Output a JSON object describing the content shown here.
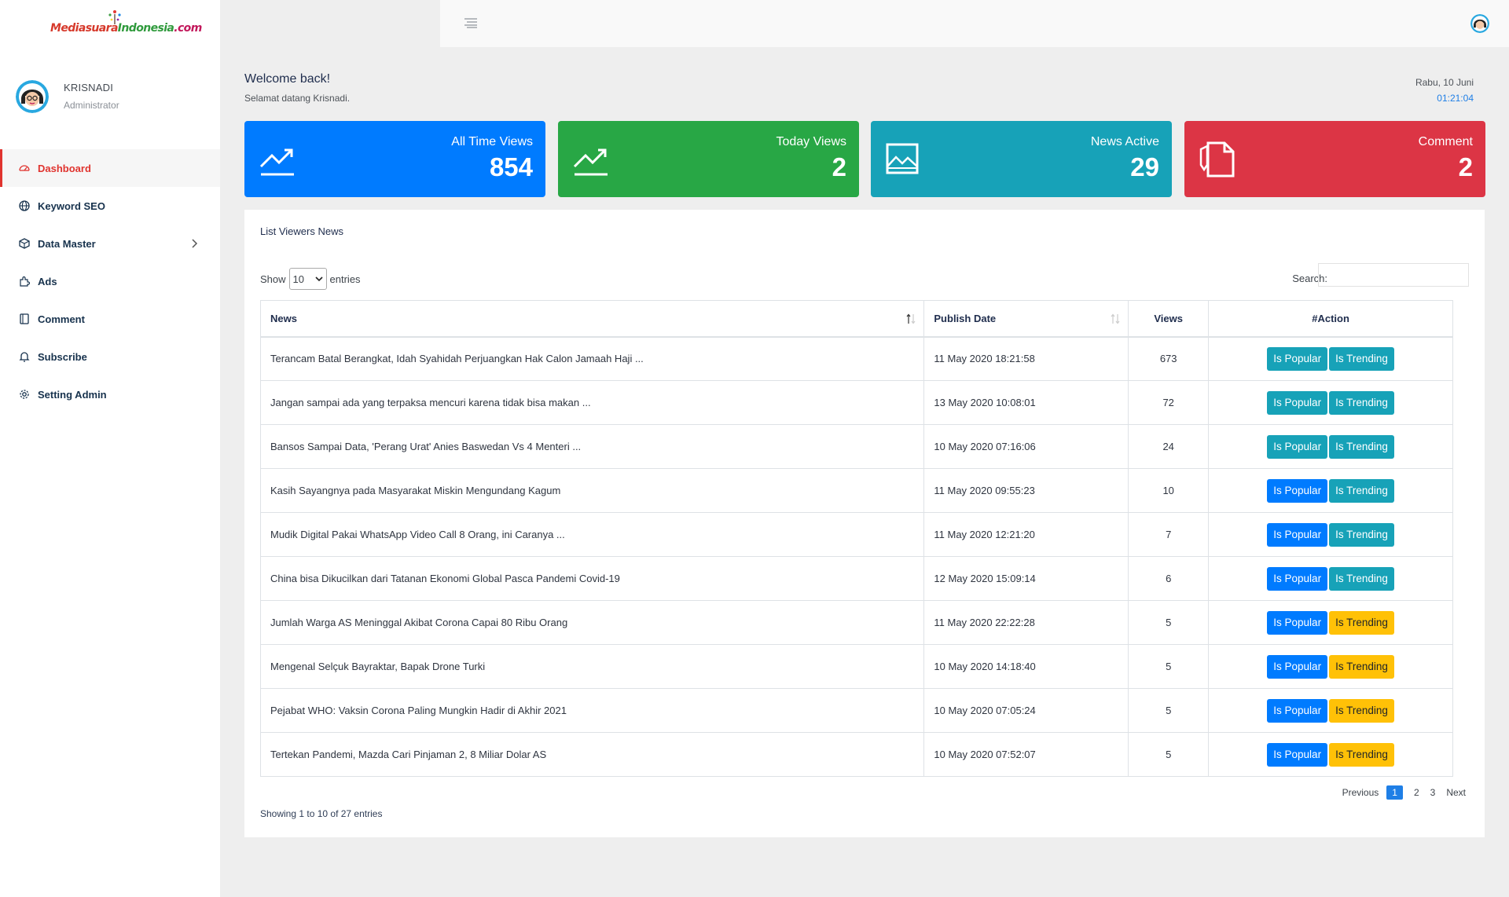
{
  "brand": {
    "logo_text_1": "Mediasuara",
    "logo_text_2": "Indonesia",
    "logo_text_3": ".com"
  },
  "profile": {
    "name": "KRISNADI",
    "role": "Administrator"
  },
  "sidebar": {
    "items": [
      {
        "label": "Dashboard",
        "icon": "speedometer-icon"
      },
      {
        "label": "Keyword SEO",
        "icon": "globe-icon"
      },
      {
        "label": "Data Master",
        "icon": "box-icon"
      },
      {
        "label": "Ads",
        "icon": "puzzle-icon"
      },
      {
        "label": "Comment",
        "icon": "book-icon"
      },
      {
        "label": "Subscribe",
        "icon": "bell-icon"
      },
      {
        "label": "Setting Admin",
        "icon": "gear-icon"
      }
    ]
  },
  "header": {
    "welcome": "Welcome back!",
    "welcome_sub": "Selamat datang Krisnadi.",
    "date": "Rabu, 10 Juni",
    "time": "01:21:04"
  },
  "cards": [
    {
      "title": "All Time Views",
      "value": "854",
      "color": "#007bff",
      "icon": "trend-up-icon"
    },
    {
      "title": "Today Views",
      "value": "2",
      "color": "#28a745",
      "icon": "trend-up-icon"
    },
    {
      "title": "News Active",
      "value": "29",
      "color": "#17a2b8",
      "icon": "image-icon"
    },
    {
      "title": "Comment",
      "value": "2",
      "color": "#dc3545",
      "icon": "document-icon"
    }
  ],
  "table": {
    "title": "List Viewers News",
    "show_label": "Show",
    "entries_label": "entries",
    "page_size": "10",
    "search_label": "Search:",
    "columns": [
      "News",
      "Publish Date",
      "Views",
      "#Action"
    ],
    "popular_label": "Is Popular",
    "trending_label": "Is Trending",
    "rows": [
      {
        "news": "Terancam Batal Berangkat, Idah Syahidah Perjuangkan Hak Calon Jamaah Haji ...",
        "date": "11 May 2020 18:21:58",
        "views": "673",
        "popular": "teal",
        "trending": "teal"
      },
      {
        "news": "Jangan sampai ada yang terpaksa mencuri karena tidak bisa makan ...",
        "date": "13 May 2020 10:08:01",
        "views": "72",
        "popular": "teal",
        "trending": "teal"
      },
      {
        "news": "Bansos Sampai Data, 'Perang Urat' Anies Baswedan Vs 4 Menteri ...",
        "date": "10 May 2020 07:16:06",
        "views": "24",
        "popular": "teal",
        "trending": "teal"
      },
      {
        "news": "Kasih Sayangnya pada Masyarakat Miskin Mengundang Kagum",
        "date": "11 May 2020 09:55:23",
        "views": "10",
        "popular": "blue",
        "trending": "teal"
      },
      {
        "news": "Mudik Digital Pakai WhatsApp Video Call 8 Orang, ini Caranya ...",
        "date": "11 May 2020 12:21:20",
        "views": "7",
        "popular": "blue",
        "trending": "teal"
      },
      {
        "news": "China bisa Dikucilkan dari Tatanan Ekonomi Global Pasca Pandemi Covid-19",
        "date": "12 May 2020 15:09:14",
        "views": "6",
        "popular": "blue",
        "trending": "teal"
      },
      {
        "news": "Jumlah Warga AS Meninggal Akibat Corona Capai 80 Ribu Orang",
        "date": "11 May 2020 22:22:28",
        "views": "5",
        "popular": "blue",
        "trending": "yellow"
      },
      {
        "news": "Mengenal Selçuk Bayraktar, Bapak Drone Turki",
        "date": "10 May 2020 14:18:40",
        "views": "5",
        "popular": "blue",
        "trending": "yellow"
      },
      {
        "news": "Pejabat WHO: Vaksin Corona Paling Mungkin Hadir di Akhir 2021",
        "date": "10 May 2020 07:05:24",
        "views": "5",
        "popular": "blue",
        "trending": "yellow"
      },
      {
        "news": "Tertekan Pandemi, Mazda Cari Pinjaman 2, 8 Miliar Dolar AS",
        "date": "10 May 2020 07:52:07",
        "views": "5",
        "popular": "blue",
        "trending": "yellow"
      }
    ],
    "showing": "Showing 1 to 10 of 27 entries",
    "pager": {
      "previous": "Previous",
      "pages": [
        "1",
        "2",
        "3"
      ],
      "next": "Next"
    }
  }
}
